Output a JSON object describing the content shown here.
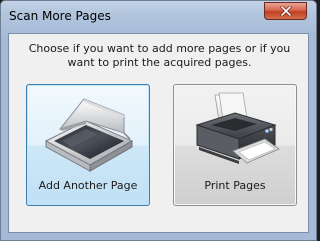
{
  "window": {
    "title": "Scan More Pages",
    "close_icon": "close-icon"
  },
  "dialog": {
    "instructions": "Choose if you want to add more pages or if you want to print the acquired pages.",
    "options": [
      {
        "label": "Add Another Page",
        "icon": "flatbed-scanner-icon",
        "selected": true
      },
      {
        "label": "Print Pages",
        "icon": "inkjet-printer-icon",
        "selected": false
      }
    ]
  },
  "colors": {
    "selected_border": "#3c7fb1",
    "selected_fill": "#e2f1fb",
    "close_button": "#c13f22",
    "dialog_background": "#f0f0f0"
  }
}
